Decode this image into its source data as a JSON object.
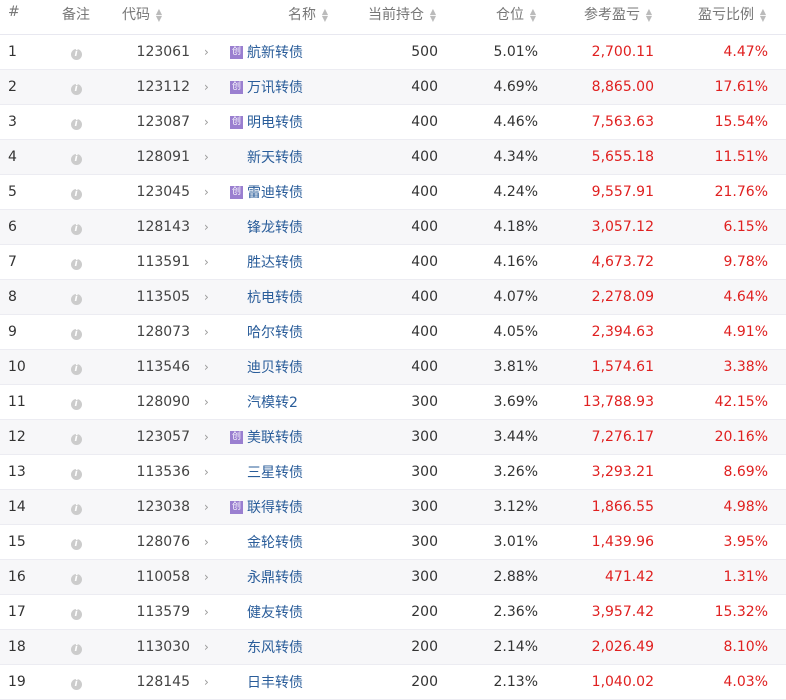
{
  "headers": {
    "idx": "#",
    "note": "备注",
    "code": "代码",
    "name": "名称",
    "hold": "当前持仓",
    "pos": "仓位",
    "pnl": "参考盈亏",
    "ratio": "盈亏比例"
  },
  "badge_label": "创",
  "info_label": "i",
  "colors": {
    "profit": "#e02020",
    "name": "#2a5d9a",
    "badge": "#9a7fd0"
  },
  "rows": [
    {
      "i": "1",
      "code": "123061",
      "badge": true,
      "name": "航新转债",
      "hold": "500",
      "pos": "5.01%",
      "pnl": "2,700.11",
      "ratio": "4.47%"
    },
    {
      "i": "2",
      "code": "123112",
      "badge": true,
      "name": "万讯转债",
      "hold": "400",
      "pos": "4.69%",
      "pnl": "8,865.00",
      "ratio": "17.61%"
    },
    {
      "i": "3",
      "code": "123087",
      "badge": true,
      "name": "明电转债",
      "hold": "400",
      "pos": "4.46%",
      "pnl": "7,563.63",
      "ratio": "15.54%"
    },
    {
      "i": "4",
      "code": "128091",
      "badge": false,
      "name": "新天转债",
      "hold": "400",
      "pos": "4.34%",
      "pnl": "5,655.18",
      "ratio": "11.51%"
    },
    {
      "i": "5",
      "code": "123045",
      "badge": true,
      "name": "雷迪转债",
      "hold": "400",
      "pos": "4.24%",
      "pnl": "9,557.91",
      "ratio": "21.76%"
    },
    {
      "i": "6",
      "code": "128143",
      "badge": false,
      "name": "锋龙转债",
      "hold": "400",
      "pos": "4.18%",
      "pnl": "3,057.12",
      "ratio": "6.15%"
    },
    {
      "i": "7",
      "code": "113591",
      "badge": false,
      "name": "胜达转债",
      "hold": "400",
      "pos": "4.16%",
      "pnl": "4,673.72",
      "ratio": "9.78%"
    },
    {
      "i": "8",
      "code": "113505",
      "badge": false,
      "name": "杭电转债",
      "hold": "400",
      "pos": "4.07%",
      "pnl": "2,278.09",
      "ratio": "4.64%"
    },
    {
      "i": "9",
      "code": "128073",
      "badge": false,
      "name": "哈尔转债",
      "hold": "400",
      "pos": "4.05%",
      "pnl": "2,394.63",
      "ratio": "4.91%"
    },
    {
      "i": "10",
      "code": "113546",
      "badge": false,
      "name": "迪贝转债",
      "hold": "400",
      "pos": "3.81%",
      "pnl": "1,574.61",
      "ratio": "3.38%"
    },
    {
      "i": "11",
      "code": "128090",
      "badge": false,
      "name": "汽模转2",
      "hold": "300",
      "pos": "3.69%",
      "pnl": "13,788.93",
      "ratio": "42.15%"
    },
    {
      "i": "12",
      "code": "123057",
      "badge": true,
      "name": "美联转债",
      "hold": "300",
      "pos": "3.44%",
      "pnl": "7,276.17",
      "ratio": "20.16%"
    },
    {
      "i": "13",
      "code": "113536",
      "badge": false,
      "name": "三星转债",
      "hold": "300",
      "pos": "3.26%",
      "pnl": "3,293.21",
      "ratio": "8.69%"
    },
    {
      "i": "14",
      "code": "123038",
      "badge": true,
      "name": "联得转债",
      "hold": "300",
      "pos": "3.12%",
      "pnl": "1,866.55",
      "ratio": "4.98%"
    },
    {
      "i": "15",
      "code": "128076",
      "badge": false,
      "name": "金轮转债",
      "hold": "300",
      "pos": "3.01%",
      "pnl": "1,439.96",
      "ratio": "3.95%"
    },
    {
      "i": "16",
      "code": "110058",
      "badge": false,
      "name": "永鼎转债",
      "hold": "300",
      "pos": "2.88%",
      "pnl": "471.42",
      "ratio": "1.31%"
    },
    {
      "i": "17",
      "code": "113579",
      "badge": false,
      "name": "健友转债",
      "hold": "200",
      "pos": "2.36%",
      "pnl": "3,957.42",
      "ratio": "15.32%"
    },
    {
      "i": "18",
      "code": "113030",
      "badge": false,
      "name": "东风转债",
      "hold": "200",
      "pos": "2.14%",
      "pnl": "2,026.49",
      "ratio": "8.10%"
    },
    {
      "i": "19",
      "code": "128145",
      "badge": false,
      "name": "日丰转债",
      "hold": "200",
      "pos": "2.13%",
      "pnl": "1,040.02",
      "ratio": "4.03%"
    }
  ]
}
